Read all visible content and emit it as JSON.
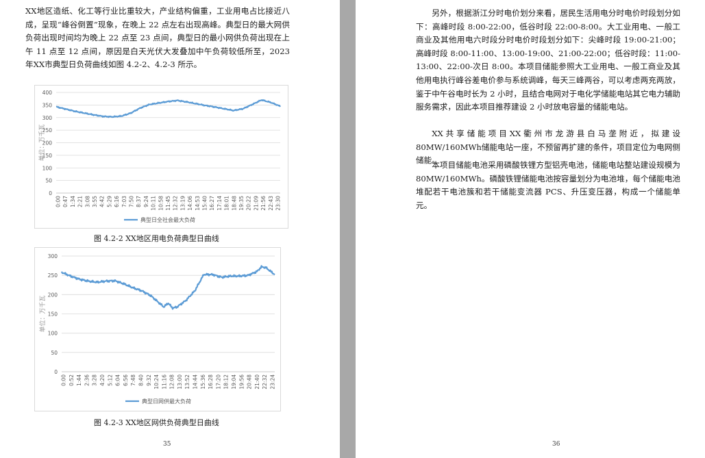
{
  "left_page": {
    "paragraph": "XX地区造纸、化工等行业比重较大，产业结构偏重，工业用电占比接近八成，呈现“峰谷倒置”现象，在晚上 22 点左右出现高峰。典型日的最大网供负荷出现时间均为晚上 22 点至 23 点间，典型日的最小网供负荷出现在上午 11 点至 12 点间，原因是白天光伏大发叠加中午负荷较低所至，2023 年XX市典型日负荷曲线如图 4.2-2、4.2-3 所示。",
    "figure1_caption": "图 4.2-2  XX地区用电负荷典型日曲线",
    "figure2_caption": "图 4.2-3  XX地区网供负荷典型日曲线",
    "page_number": "35"
  },
  "right_page": {
    "paragraph1": "另外，根据浙江分时电价划分来看，居民生活用电分时电价时段划分如下：高峰时段 8:00-22:00，低谷时段 22:00-8:00。大工业用电、一般工商业及其他用电六时段分时电价时段划分如下：尖峰时段 19:00-21:00；高峰时段 8:00-11:00、13:00-19:00、21:00-22:00；低谷时段：11:00-13:00、22:00-次日 8:00。本项目储能参照大工业用电、一般工商业及其他用电执行峰谷差电价参与系统调峰，每天三峰两谷，可以考虑两充两放，鉴于中午谷电时长为 2 小时，且结合电网对于电化学储能电站其它电力辅助服务需求，因此本项目推荐建设 2 小时放电容量的储能电站。",
    "paragraph2": "XX共享储能项目XX衢州市龙游县白马垄附近，拟建设 80MW/160MWh储能电站一座，不预留再扩建的条件，项目定位为电网侧储能。",
    "paragraph3": "本项目储能电池采用磷酸铁锂方型铝壳电池，储能电站整站建设规模为80MW/160MWh。磷酸铁锂储能电池按容量划分为电池堆，每个储能电池堆配若干电池簇和若干储能变流器 PCS、升压变压器，构成一个储能单元。",
    "page_number": "36"
  },
  "chart_data": [
    {
      "type": "line",
      "ylabel": "单位：万千瓦",
      "ylim": [
        0,
        400
      ],
      "yticks": [
        0,
        50,
        100,
        150,
        200,
        250,
        300,
        350,
        400
      ],
      "xticklabels": [
        "0:00",
        "0:47",
        "1:34",
        "2:21",
        "3:08",
        "3:55",
        "4:42",
        "5:29",
        "6:16",
        "7:03",
        "7:50",
        "8:37",
        "9:24",
        "10:11",
        "10:58",
        "11:45",
        "12:32",
        "13:19",
        "14:06",
        "14:53",
        "15:40",
        "16:27",
        "17:14",
        "18:01",
        "18:48",
        "19:35",
        "20:22",
        "21:09",
        "21:56",
        "22:43",
        "23:30"
      ],
      "color": "#5b9bd5",
      "series": [
        {
          "name": "典型日全社会最大负荷",
          "x_hours": [
            0,
            1,
            2,
            3,
            4,
            5,
            6,
            7,
            8,
            9,
            10,
            11,
            12,
            13,
            14,
            15,
            16,
            17,
            18,
            19,
            20,
            21,
            22,
            23,
            24
          ],
          "values": [
            343,
            334,
            325,
            318,
            311,
            305,
            303,
            306,
            318,
            338,
            352,
            358,
            364,
            368,
            362,
            355,
            348,
            342,
            335,
            328,
            335,
            352,
            370,
            360,
            345
          ]
        }
      ]
    },
    {
      "type": "line",
      "ylabel": "单位：万千瓦",
      "ylim": [
        0,
        300
      ],
      "yticks": [
        0,
        50,
        100,
        150,
        200,
        250,
        300
      ],
      "xticklabels": [
        "0:00",
        "0:52",
        "1:44",
        "2:36",
        "3:28",
        "4:20",
        "5:12",
        "6:04",
        "6:56",
        "7:48",
        "8:40",
        "9:32",
        "10:24",
        "11:16",
        "12:08",
        "13:00",
        "13:52",
        "14:44",
        "15:36",
        "16:28",
        "17:20",
        "18:12",
        "19:04",
        "19:56",
        "20:48",
        "21:40",
        "22:32",
        "23:24"
      ],
      "color": "#5b9bd5",
      "series": [
        {
          "name": "典型日网供最大负荷",
          "x_hours": [
            0,
            1,
            2,
            3,
            4,
            5,
            6,
            7,
            8,
            9,
            10,
            11,
            11.5,
            12,
            12.5,
            13,
            14,
            15,
            16,
            17,
            18,
            19,
            20,
            21,
            22,
            22.5,
            23,
            24
          ],
          "values": [
            258,
            248,
            240,
            235,
            232,
            235,
            236,
            228,
            218,
            210,
            198,
            178,
            168,
            178,
            165,
            168,
            185,
            210,
            252,
            252,
            245,
            248,
            248,
            250,
            260,
            272,
            270,
            252
          ]
        }
      ]
    }
  ]
}
